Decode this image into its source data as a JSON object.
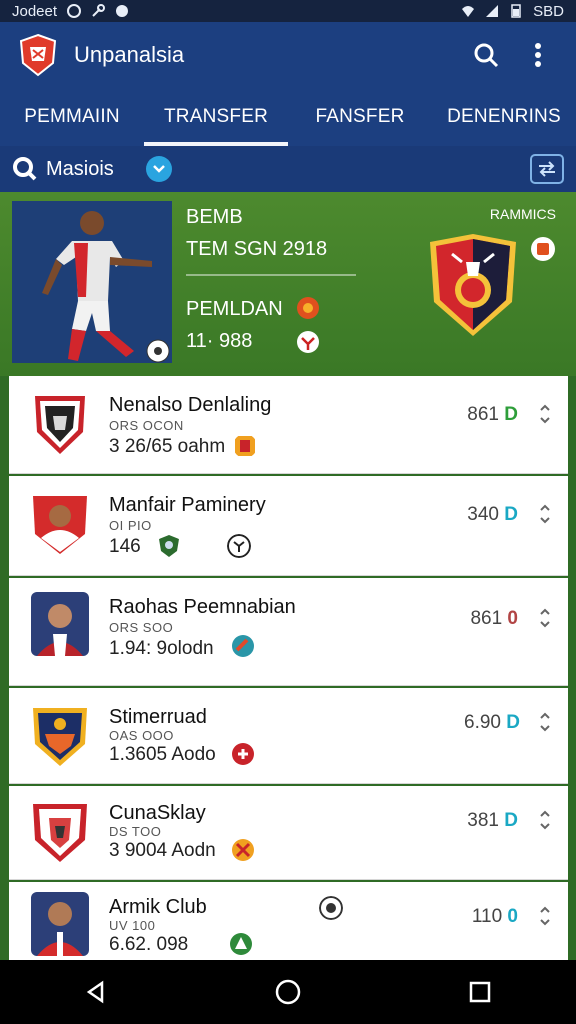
{
  "status_bar": {
    "left_text": "Jodeet",
    "right_text": "SBD"
  },
  "app": {
    "title": "Unpanalsia"
  },
  "tabs": [
    {
      "label": "PEMMAIIN",
      "active": false
    },
    {
      "label": "TRANSFER",
      "active": true
    },
    {
      "label": "FANSFER",
      "active": false
    },
    {
      "label": "DENENRINS",
      "active": false
    }
  ],
  "filter": {
    "label": "Masiois"
  },
  "hero": {
    "label_small": "RAMMICS",
    "line1": "BEMB",
    "line2": "TEM SGN  2918",
    "line3": "PEMLDAN",
    "line4": "11·  988"
  },
  "rows": [
    {
      "name": "Nenalso Denlaling",
      "sub": "ORS OCON",
      "meta": "3 26/65 oahm",
      "value": "861",
      "accent": "D",
      "accent_color": "#2e9e3a"
    },
    {
      "name": "Manfair Paminery",
      "sub": "OI PIO",
      "meta": "146",
      "value": "340",
      "accent": "D",
      "accent_color": "#1aa8c4"
    },
    {
      "name": "Raohas Peemnabian",
      "sub": "ORS SOO",
      "meta": "1.94: 9olodn",
      "value": "861",
      "accent": "0",
      "accent_color": "#b24545"
    },
    {
      "name": "Stimerruad",
      "sub": "OAS OOO",
      "meta": "1.3605 Aodo",
      "value": "6.90",
      "accent": "D",
      "accent_color": "#1aa8c4"
    },
    {
      "name": "CunaSklay",
      "sub": "DS TOO",
      "meta": "3 9004 Aodn",
      "value": "381",
      "accent": "D",
      "accent_color": "#1aa8c4"
    },
    {
      "name": "Armik Club",
      "sub": "UV 100",
      "meta": "6.62. 098",
      "value": "110",
      "accent": "0",
      "accent_color": "#1aa8c4"
    }
  ],
  "colors": {
    "primary": "#1c3f80",
    "field": "#3a7826",
    "accent_green": "#2e9e3a",
    "accent_teal": "#1aa8c4"
  }
}
